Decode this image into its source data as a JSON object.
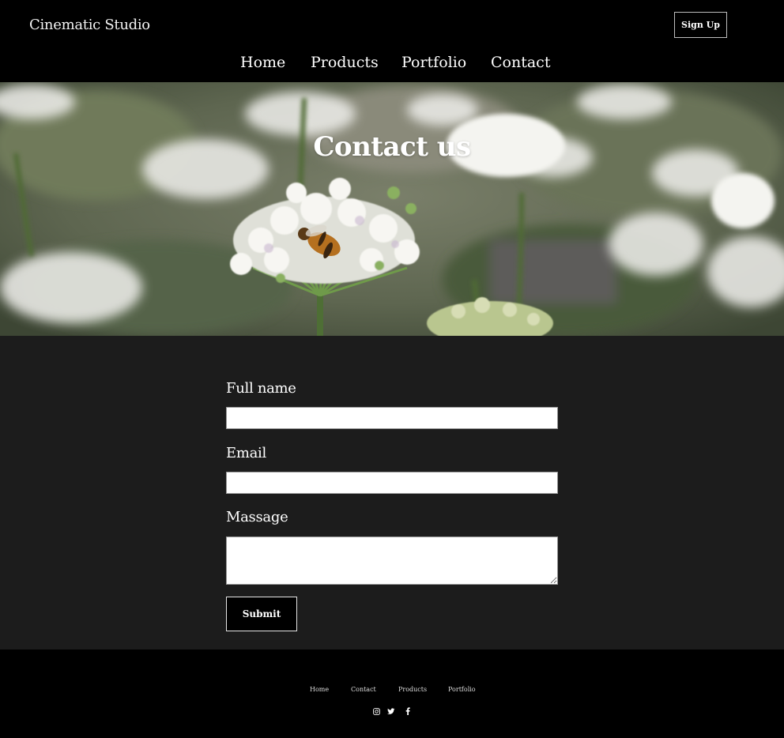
{
  "brand": {
    "name": "Cinematic Studio"
  },
  "header": {
    "signup_label": "Sign Up"
  },
  "nav": {
    "items": [
      "Home",
      "Products",
      "Portfolio",
      "Contact"
    ]
  },
  "hero": {
    "title": "Contact us",
    "image": "flower-with-bee-photo"
  },
  "form": {
    "fullname_label": "Full name",
    "fullname_value": "",
    "email_label": "Email",
    "email_value": "",
    "message_label": "Massage",
    "message_value": "",
    "submit_label": "Submit"
  },
  "footer": {
    "links": [
      "Home",
      "Contact",
      "Products",
      "Portfolio"
    ],
    "social_icons": [
      "instagram-icon",
      "twitter-icon",
      "facebook-icon"
    ]
  },
  "colors": {
    "header_bg": "#000000",
    "form_bg": "#1c1c1c",
    "text": "#ffffff",
    "input_bg": "#ffffff"
  }
}
